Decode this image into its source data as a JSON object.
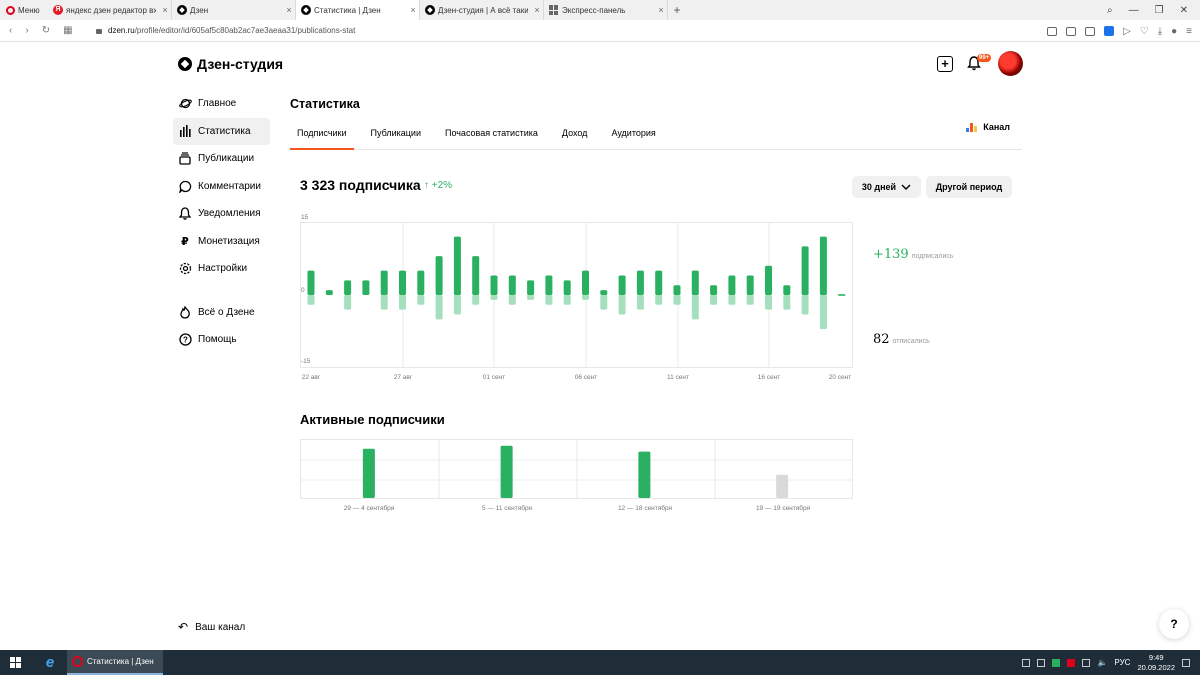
{
  "browser": {
    "menu_label": "Меню",
    "tabs": [
      {
        "title": "яндекс дзен редактор вход"
      },
      {
        "title": "Дзен"
      },
      {
        "title": "Статистика | Дзен"
      },
      {
        "title": "Дзен-студия | А всё таки з"
      },
      {
        "title": "Экспресс-панель"
      }
    ],
    "url_host": "dzen.ru",
    "url_path": "/profile/editor/id/605af5c80ab2ac7ae3aeaa31/publications-stat"
  },
  "header": {
    "logo": "Дзен-студия",
    "notif_badge": "99+"
  },
  "sidebar": {
    "items": [
      {
        "label": "Главное",
        "icon": "planet-icon"
      },
      {
        "label": "Статистика",
        "icon": "stats-icon"
      },
      {
        "label": "Публикации",
        "icon": "publications-icon"
      },
      {
        "label": "Комментарии",
        "icon": "comment-icon"
      },
      {
        "label": "Уведомления",
        "icon": "bell-icon"
      },
      {
        "label": "Монетизация",
        "icon": "ruble-icon"
      },
      {
        "label": "Настройки",
        "icon": "gear-icon"
      }
    ],
    "secondary": [
      {
        "label": "Всё о Дзене",
        "icon": "fire-icon"
      },
      {
        "label": "Помощь",
        "icon": "help-icon"
      }
    ],
    "your_channel": "Ваш канал"
  },
  "main": {
    "title": "Статистика",
    "tabs": [
      "Подписчики",
      "Публикации",
      "Почасовая статистика",
      "Доход",
      "Аудитория"
    ],
    "active_tab": "Подписчики",
    "channel_label": "Канал",
    "subscribers": "3 323 подписчика",
    "growth": "+2%",
    "period_button": "30 дней",
    "other_period_button": "Другой период",
    "subscribed": "+139",
    "subscribed_label": "подписались",
    "unsubscribed": "82",
    "unsubscribed_label": "отписались",
    "active_title": "Активные подписчики",
    "help": "?"
  },
  "colors": {
    "green": "#2ab061",
    "green_light": "#a6dfbe",
    "accent_orange": "#f5561b",
    "grey_bar": "#d9d9d9"
  },
  "chart_data": [
    {
      "type": "bar",
      "title": "",
      "ylim": [
        -15,
        15
      ],
      "yticks": [
        "15",
        "0",
        "-15"
      ],
      "xticks": [
        "22 авг",
        "27 авг",
        "01 сент",
        "06 сент",
        "11 сент",
        "16 сент",
        "20 сент"
      ],
      "categories": [
        "22 авг",
        "23 авг",
        "24 авг",
        "25 авг",
        "26 авг",
        "27 авг",
        "28 авг",
        "29 авг",
        "30 авг",
        "31 авг",
        "01 сент",
        "02 сент",
        "03 сент",
        "04 сент",
        "05 сент",
        "06 сент",
        "07 сент",
        "08 сент",
        "09 сент",
        "10 сент",
        "11 сент",
        "12 сент",
        "13 сент",
        "14 сент",
        "15 сент",
        "16 сент",
        "17 сент",
        "18 сент",
        "19 сент",
        "20 сент"
      ],
      "series": [
        {
          "name": "подписались",
          "values": [
            5,
            1,
            3,
            3,
            5,
            5,
            5,
            8,
            12,
            8,
            4,
            4,
            3,
            4,
            3,
            5,
            1,
            4,
            5,
            5,
            2,
            5,
            2,
            4,
            4,
            6,
            2,
            10,
            12,
            0
          ]
        },
        {
          "name": "отписались",
          "values": [
            -2,
            0,
            -3,
            0,
            -3,
            -3,
            -2,
            -5,
            -4,
            -2,
            -1,
            -2,
            -1,
            -2,
            -2,
            -1,
            -3,
            -4,
            -3,
            -2,
            -2,
            -5,
            -2,
            -2,
            -2,
            -3,
            -3,
            -4,
            -7,
            0
          ]
        }
      ]
    },
    {
      "type": "bar",
      "title": "Активные подписчики",
      "categories": [
        "29 — 4 сентября",
        "5 — 11 сентября",
        "12 — 18 сентября",
        "19 — 19 сентября"
      ],
      "values": [
        0.85,
        0.9,
        0.8,
        0.4
      ],
      "value_scale": "relative"
    }
  ]
}
